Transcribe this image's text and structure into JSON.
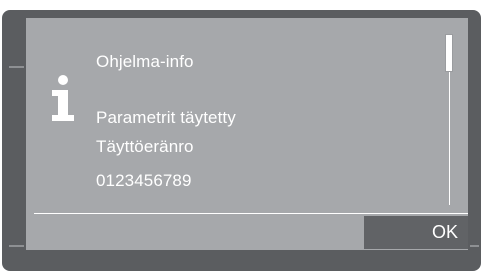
{
  "dialog": {
    "title": "Ohjelma-info",
    "lines": [
      "Parametrit täytetty",
      "Täyttöeränro",
      "0123456789"
    ],
    "icon": "info-icon",
    "ok_label": "OK"
  },
  "colors": {
    "frame": "#5b5d60",
    "screen": "#a6a8ab",
    "text": "#ffffff",
    "button": "#616366"
  }
}
